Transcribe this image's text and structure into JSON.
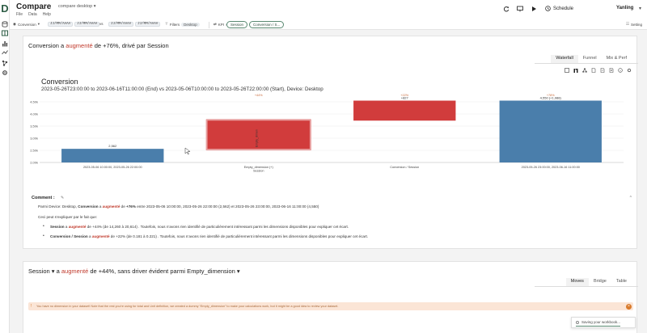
{
  "app": {
    "title": "Compare",
    "document": "compare desktop ▾",
    "menu": [
      "File",
      "Data",
      "Help"
    ],
    "schedule_label": "Schedule",
    "user": "Yanling",
    "brand_color": "#2e5d45"
  },
  "filters": {
    "metric": "Conversion",
    "range1_start": "JJ/MM/AAAA",
    "range1_end": "JJ/MM/AAAA",
    "vs": "vs",
    "range2_start": "JJ/MM/AAAA",
    "range2_end": "JJ/MM/AAAA",
    "filters_label": "Filters",
    "filter_chip": "Desktop",
    "kpi_label": "KPI",
    "kpi_pill1": "Session",
    "kpi_pill2": "Conversion / S...",
    "settings_label": "Setting"
  },
  "card1": {
    "title_pre": "Conversion a ",
    "title_red": "augmenté",
    "title_post": " de +76%, drivé par Session",
    "tabs": [
      "Waterfall",
      "Funnel",
      "Mix & Perf"
    ],
    "chart_title": "Conversion",
    "chart_subtitle": "2023-05-26T23:00:00 to 2023-06-16T11:00:00 (End) vs 2023-05-06T10:00:00 to 2023-05-26T22:00:00 (Start), Device: Desktop",
    "comment_label": "Comment :",
    "comment_edit": "✎",
    "collapse_icon": "^",
    "comment": {
      "l1_a": "Parmi Device: Desktop, ",
      "l1_b": "Conversion",
      "l1_c": " a ",
      "l1_d": "augmenté",
      "l1_e": " de ",
      "l1_f": "+76%",
      "l1_g": " entre 2023-05-06 10:00:00, 2023-05-26 22:00:00 (2,562) et 2023-05-26 23:00:00, 2023-06-16 11:00:00 (4,550)",
      "l2": "Ceci peut s’expliquer par le fait que:",
      "b1_a": "Session",
      "b1_b": " a ",
      "b1_c": "augmenté",
      "b1_d": " de +44% (de 14,260 à 20,614) . Toutefois, nous n’avons rien identifié de particulièrement intéressant parmi les dimensions disponibles pour expliquer cet écart.",
      "b2_a": "Conversion / Session",
      "b2_b": " a ",
      "b2_c": "augmenté",
      "b2_d": " de +22% (de 0.181 à 0.221) . Toutefois, nous n’avons rien identifié de particulièrement intéressant parmi les dimensions disponibles pour expliquer cet écart."
    }
  },
  "chart_data": {
    "type": "bar",
    "subtype": "waterfall",
    "title": "Conversion",
    "categories": [
      "2023-05-06 10:00:00, 2023-05-26 22:00:00",
      "Empty_dimension (+)\nSession",
      "Conversion / Session",
      "2023-05-26 23:00:00, 2023-06-16 11:00:00"
    ],
    "bars": [
      {
        "start": 0,
        "end": 2562,
        "label": "2,562",
        "color": "#4a7eab"
      },
      {
        "start": 2562,
        "end": 3725,
        "label": "",
        "pct": "+44%",
        "color": "#d13c3c",
        "inner_label": "Empty_dimen"
      },
      {
        "start": 3725,
        "end": 4550,
        "label": "+827",
        "pct": "+22%",
        "color": "#d13c3c"
      },
      {
        "start": 0,
        "end": 4550,
        "label": "4,550 (+1,988)",
        "pct": "+78%",
        "color": "#4a7eab"
      }
    ],
    "y_ticks": [
      "2,00k",
      "2,50k",
      "3,00k",
      "3,50k",
      "4,00k",
      "4,50k"
    ],
    "ylim": [
      2000,
      4700
    ],
    "grid": true,
    "legend": "none"
  },
  "card2": {
    "title_a": "Session",
    "title_b": " a ",
    "title_c": "augmenté",
    "title_d": " de +44%, sans driver évident parmi Empty_dimension",
    "tabs": [
      "Moves",
      "Bridge",
      "Table"
    ],
    "warning": "You have no dimension in your dataset! Note that the rest you’re using for total and Unit definition, we created a dummy “Empty_dimension” to make your calculations work, but it might be a good idea to review your dataset."
  },
  "toast": {
    "text": "Saving your workbook..."
  }
}
